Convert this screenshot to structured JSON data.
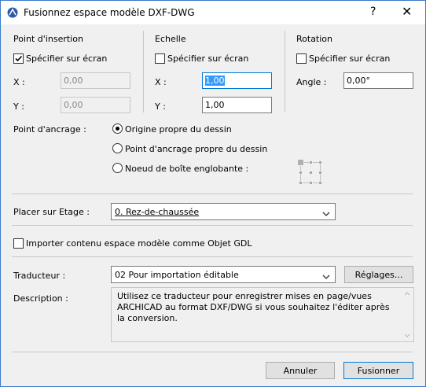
{
  "window": {
    "title": "Fusionnez espace modèle DXF-DWG",
    "help": "?",
    "close": "✕"
  },
  "insertion": {
    "header": "Point d'insertion",
    "specify_label": "Spécifier sur écran",
    "specify_checked": true,
    "x_label": "X :",
    "x_value": "0,00",
    "y_label": "Y :",
    "y_value": "0,00"
  },
  "scale": {
    "header": "Echelle",
    "specify_label": "Spécifier sur écran",
    "specify_checked": false,
    "x_label": "X :",
    "x_value": "1,00",
    "y_label": "Y :",
    "y_value": "1,00"
  },
  "rotation": {
    "header": "Rotation",
    "specify_label": "Spécifier sur écran",
    "specify_checked": false,
    "angle_label": "Angle :",
    "angle_value": "0,00°"
  },
  "anchor": {
    "label": "Point d'ancrage :",
    "options": [
      "Origine propre du dessin",
      "Point d'ancrage propre du dessin",
      "Noeud de boîte englobante :"
    ],
    "selected_index": 0
  },
  "story": {
    "label": "Placer sur Etage :",
    "value": "0. Rez-de-chaussée"
  },
  "gdl": {
    "label": "Importer contenu espace modèle comme Objet GDL",
    "checked": false
  },
  "translator": {
    "label": "Traducteur :",
    "value": "02 Pour importation éditable",
    "settings_button": "Réglages..."
  },
  "description": {
    "label": "Description :",
    "text": "Utilisez ce traducteur pour enregistrer mises en page/vues ARCHICAD au format DXF/DWG si vous souhaitez l'éditer après la conversion."
  },
  "buttons": {
    "cancel": "Annuler",
    "merge": "Fusionner"
  },
  "colors": {
    "accent": "#0078d7",
    "selection": "#3399ff",
    "dialog_bg": "#f0f0f0"
  }
}
